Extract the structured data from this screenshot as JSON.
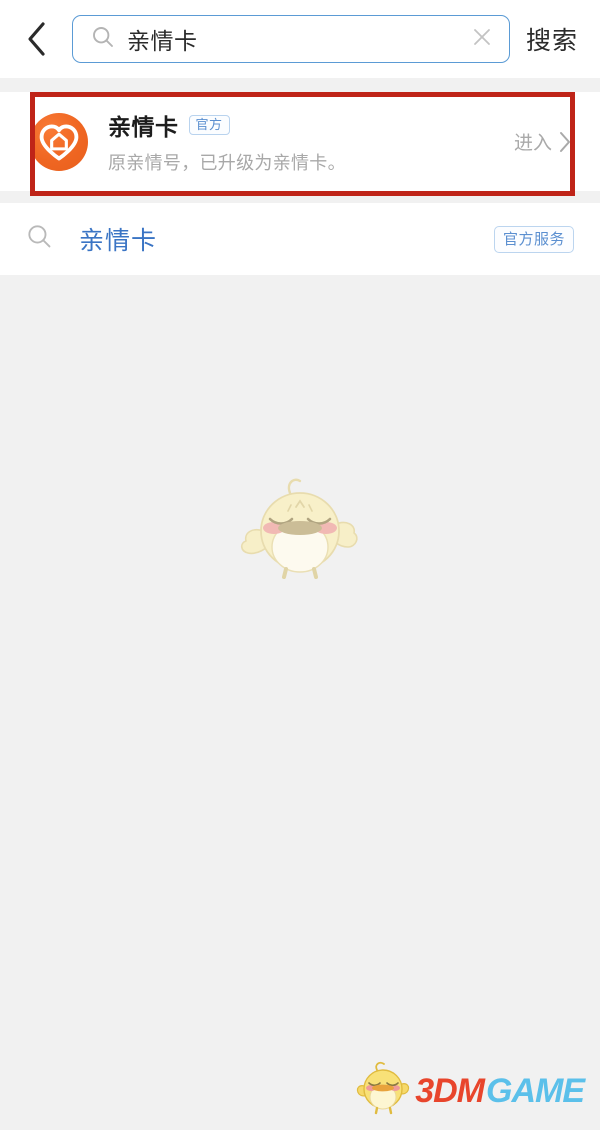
{
  "header": {
    "back_icon": "chevron-left-icon",
    "search": {
      "icon": "search-icon",
      "value": "亲情卡",
      "placeholder": "搜索",
      "clear_icon": "close-icon"
    },
    "action_label": "搜索"
  },
  "results": {
    "card": {
      "logo_icon": "heart-home-logo-icon",
      "logo_color": "#ef6622",
      "title": "亲情卡",
      "badge": "官方",
      "subtitle": "原亲情号，已升级为亲情卡。",
      "enter_label": "进入",
      "enter_icon": "chevron-right-icon"
    },
    "annotation": {
      "color": "#bf2418"
    },
    "suggestion": {
      "icon": "search-icon",
      "text": "亲情卡",
      "badge": "官方服务",
      "text_color": "#3a74c4"
    }
  },
  "empty_state": {
    "mascot_icon": "chick-mascot-illustration"
  },
  "watermark": {
    "mascot_icon": "chick-mascot-icon",
    "brand_primary": "3DM",
    "brand_secondary": "GAME",
    "primary_color": "#e8452c",
    "secondary_color": "#5bc0ea"
  }
}
